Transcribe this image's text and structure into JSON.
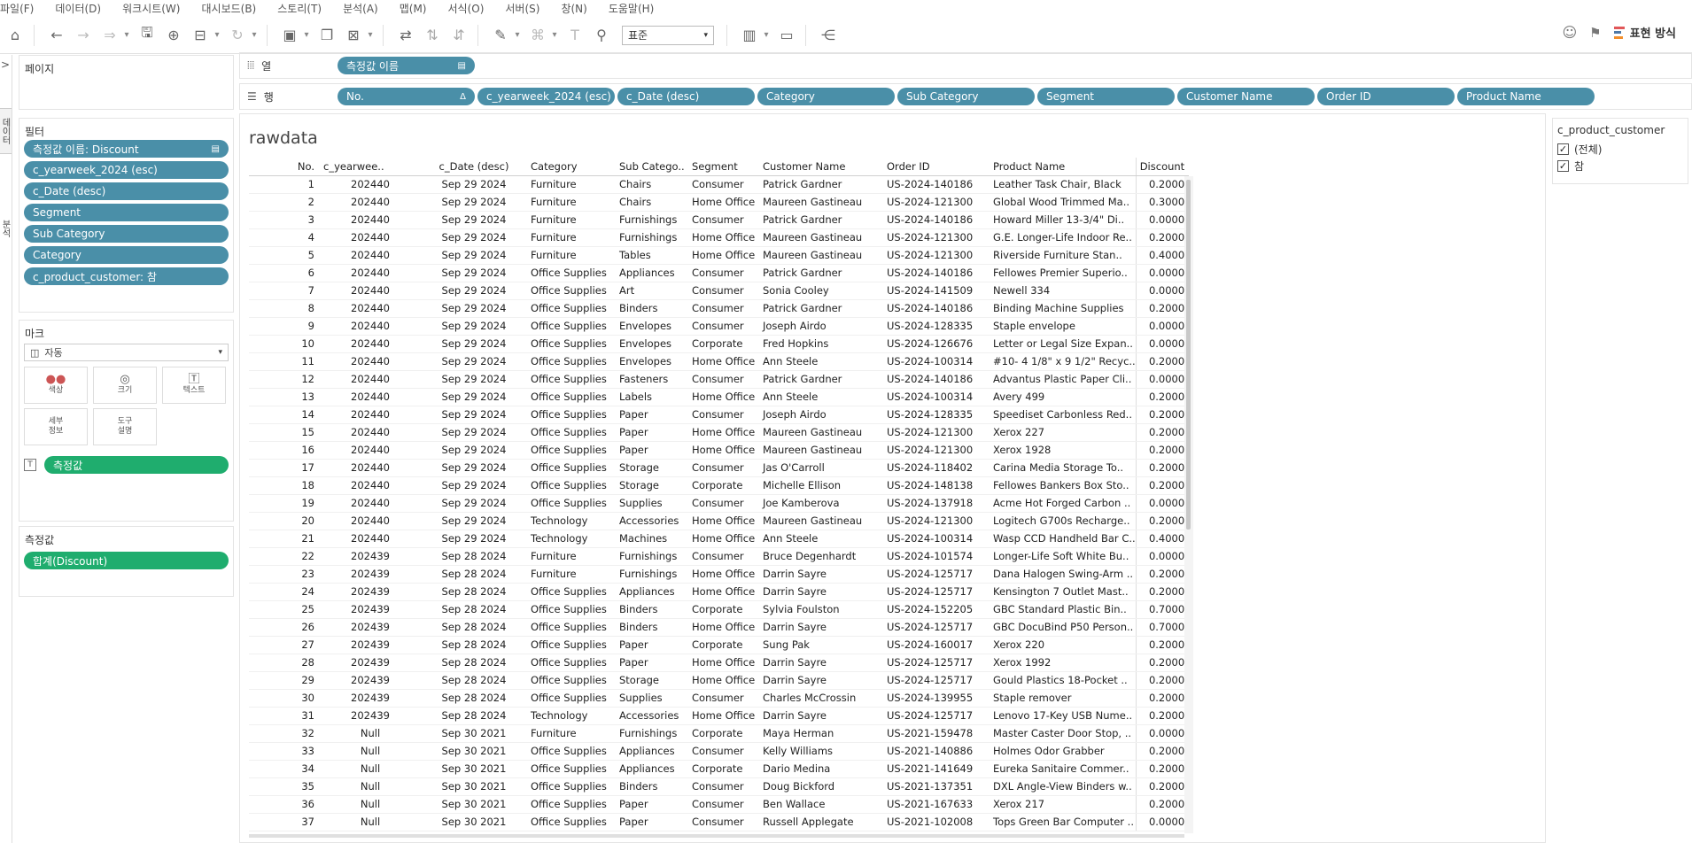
{
  "menu": [
    "파일(F)",
    "데이터(D)",
    "워크시트(W)",
    "대시보드(B)",
    "스토리(T)",
    "분석(A)",
    "맵(M)",
    "서식(O)",
    "서버(S)",
    "창(N)",
    "도움말(H)"
  ],
  "toolbar": {
    "fit_value": "표준",
    "show_me_label": "표현 방식",
    "show_me_colors": [
      "#e15759",
      "#4e79a7",
      "#f28e2b"
    ]
  },
  "left_strip": {
    "tab_top": "데이터",
    "tab_mid": "분석"
  },
  "pages_card": {
    "title": "페이지"
  },
  "filters_card": {
    "title": "필터",
    "items": [
      "측정값 이름: Discount",
      "c_yearweek_2024 (esc)",
      "c_Date (desc)",
      "Segment",
      "Sub Category",
      "Category",
      "c_product_customer: 참"
    ]
  },
  "marks_card": {
    "title": "마크",
    "type_value": "자동",
    "buttons": {
      "color": "색상",
      "size": "크기",
      "text": "텍스트",
      "detail": "세부\n정보",
      "tooltip": "도구\n설명"
    },
    "text_pill": "측정값"
  },
  "measure_values_card": {
    "title": "측정값",
    "items": [
      "합계(Discount)"
    ]
  },
  "columns_shelf": {
    "label": "열",
    "pills": [
      "측정값 이름"
    ]
  },
  "rows_shelf": {
    "label": "행",
    "pills": [
      "No.",
      "c_yearweek_2024 (esc)",
      "c_Date (desc)",
      "Category",
      "Sub Category",
      "Segment",
      "Customer Name",
      "Order ID",
      "Product Name"
    ],
    "first_pill_marker": "Δ"
  },
  "view": {
    "title": "rawdata",
    "headers": [
      "No.",
      "c_yearwee..",
      "c_Date (desc)",
      "Category",
      "Sub Catego..",
      "Segment",
      "Customer Name",
      "Order ID",
      "Product Name",
      "Discount"
    ],
    "rows": [
      [
        "1",
        "202440",
        "Sep 29 2024",
        "Furniture",
        "Chairs",
        "Consumer",
        "Patrick Gardner",
        "US-2024-140186",
        "Leather Task Chair, Black",
        "0.2000"
      ],
      [
        "2",
        "202440",
        "Sep 29 2024",
        "Furniture",
        "Chairs",
        "Home Office",
        "Maureen Gastineau",
        "US-2024-121300",
        "Global Wood Trimmed Ma..",
        "0.3000"
      ],
      [
        "3",
        "202440",
        "Sep 29 2024",
        "Furniture",
        "Furnishings",
        "Consumer",
        "Patrick Gardner",
        "US-2024-140186",
        "Howard Miller 13-3/4\" Di..",
        "0.0000"
      ],
      [
        "4",
        "202440",
        "Sep 29 2024",
        "Furniture",
        "Furnishings",
        "Home Office",
        "Maureen Gastineau",
        "US-2024-121300",
        "G.E. Longer-Life Indoor Re..",
        "0.2000"
      ],
      [
        "5",
        "202440",
        "Sep 29 2024",
        "Furniture",
        "Tables",
        "Home Office",
        "Maureen Gastineau",
        "US-2024-121300",
        "Riverside Furniture Stan..",
        "0.4000"
      ],
      [
        "6",
        "202440",
        "Sep 29 2024",
        "Office Supplies",
        "Appliances",
        "Consumer",
        "Patrick Gardner",
        "US-2024-140186",
        "Fellowes Premier Superio..",
        "0.0000"
      ],
      [
        "7",
        "202440",
        "Sep 29 2024",
        "Office Supplies",
        "Art",
        "Consumer",
        "Sonia Cooley",
        "US-2024-141509",
        "Newell 334",
        "0.0000"
      ],
      [
        "8",
        "202440",
        "Sep 29 2024",
        "Office Supplies",
        "Binders",
        "Consumer",
        "Patrick Gardner",
        "US-2024-140186",
        "Binding Machine Supplies",
        "0.2000"
      ],
      [
        "9",
        "202440",
        "Sep 29 2024",
        "Office Supplies",
        "Envelopes",
        "Consumer",
        "Joseph Airdo",
        "US-2024-128335",
        "Staple envelope",
        "0.0000"
      ],
      [
        "10",
        "202440",
        "Sep 29 2024",
        "Office Supplies",
        "Envelopes",
        "Corporate",
        "Fred Hopkins",
        "US-2024-126676",
        "Letter or Legal Size Expan..",
        "0.0000"
      ],
      [
        "11",
        "202440",
        "Sep 29 2024",
        "Office Supplies",
        "Envelopes",
        "Home Office",
        "Ann Steele",
        "US-2024-100314",
        "#10- 4 1/8\" x 9 1/2\" Recyc..",
        "0.2000"
      ],
      [
        "12",
        "202440",
        "Sep 29 2024",
        "Office Supplies",
        "Fasteners",
        "Consumer",
        "Patrick Gardner",
        "US-2024-140186",
        "Advantus Plastic Paper Cli..",
        "0.0000"
      ],
      [
        "13",
        "202440",
        "Sep 29 2024",
        "Office Supplies",
        "Labels",
        "Home Office",
        "Ann Steele",
        "US-2024-100314",
        "Avery 499",
        "0.2000"
      ],
      [
        "14",
        "202440",
        "Sep 29 2024",
        "Office Supplies",
        "Paper",
        "Consumer",
        "Joseph Airdo",
        "US-2024-128335",
        "Speediset Carbonless Red..",
        "0.2000"
      ],
      [
        "15",
        "202440",
        "Sep 29 2024",
        "Office Supplies",
        "Paper",
        "Home Office",
        "Maureen Gastineau",
        "US-2024-121300",
        "Xerox 227",
        "0.2000"
      ],
      [
        "16",
        "202440",
        "Sep 29 2024",
        "Office Supplies",
        "Paper",
        "Home Office",
        "Maureen Gastineau",
        "US-2024-121300",
        "Xerox 1928",
        "0.2000"
      ],
      [
        "17",
        "202440",
        "Sep 29 2024",
        "Office Supplies",
        "Storage",
        "Consumer",
        "Jas O'Carroll",
        "US-2024-118402",
        "Carina Media Storage To..",
        "0.2000"
      ],
      [
        "18",
        "202440",
        "Sep 29 2024",
        "Office Supplies",
        "Storage",
        "Corporate",
        "Michelle Ellison",
        "US-2024-148138",
        "Fellowes Bankers Box Sto..",
        "0.2000"
      ],
      [
        "19",
        "202440",
        "Sep 29 2024",
        "Office Supplies",
        "Supplies",
        "Consumer",
        "Joe Kamberova",
        "US-2024-137918",
        "Acme Hot Forged Carbon ..",
        "0.0000"
      ],
      [
        "20",
        "202440",
        "Sep 29 2024",
        "Technology",
        "Accessories",
        "Home Office",
        "Maureen Gastineau",
        "US-2024-121300",
        "Logitech G700s Recharge..",
        "0.2000"
      ],
      [
        "21",
        "202440",
        "Sep 29 2024",
        "Technology",
        "Machines",
        "Home Office",
        "Ann Steele",
        "US-2024-100314",
        "Wasp CCD Handheld Bar C..",
        "0.4000"
      ],
      [
        "22",
        "202439",
        "Sep 28 2024",
        "Furniture",
        "Furnishings",
        "Consumer",
        "Bruce Degenhardt",
        "US-2024-101574",
        "Longer-Life Soft White Bu..",
        "0.0000"
      ],
      [
        "23",
        "202439",
        "Sep 28 2024",
        "Furniture",
        "Furnishings",
        "Home Office",
        "Darrin Sayre",
        "US-2024-125717",
        "Dana Halogen Swing-Arm ..",
        "0.2000"
      ],
      [
        "24",
        "202439",
        "Sep 28 2024",
        "Office Supplies",
        "Appliances",
        "Home Office",
        "Darrin Sayre",
        "US-2024-125717",
        "Kensington 7 Outlet Mast..",
        "0.2000"
      ],
      [
        "25",
        "202439",
        "Sep 28 2024",
        "Office Supplies",
        "Binders",
        "Corporate",
        "Sylvia Foulston",
        "US-2024-152205",
        "GBC Standard Plastic Bin..",
        "0.7000"
      ],
      [
        "26",
        "202439",
        "Sep 28 2024",
        "Office Supplies",
        "Binders",
        "Home Office",
        "Darrin Sayre",
        "US-2024-125717",
        "GBC DocuBind P50 Person..",
        "0.7000"
      ],
      [
        "27",
        "202439",
        "Sep 28 2024",
        "Office Supplies",
        "Paper",
        "Corporate",
        "Sung Pak",
        "US-2024-160017",
        "Xerox 220",
        "0.2000"
      ],
      [
        "28",
        "202439",
        "Sep 28 2024",
        "Office Supplies",
        "Paper",
        "Home Office",
        "Darrin Sayre",
        "US-2024-125717",
        "Xerox 1992",
        "0.2000"
      ],
      [
        "29",
        "202439",
        "Sep 28 2024",
        "Office Supplies",
        "Storage",
        "Home Office",
        "Darrin Sayre",
        "US-2024-125717",
        "Gould Plastics 18-Pocket ..",
        "0.2000"
      ],
      [
        "30",
        "202439",
        "Sep 28 2024",
        "Office Supplies",
        "Supplies",
        "Consumer",
        "Charles McCrossin",
        "US-2024-139955",
        "Staple remover",
        "0.2000"
      ],
      [
        "31",
        "202439",
        "Sep 28 2024",
        "Technology",
        "Accessories",
        "Home Office",
        "Darrin Sayre",
        "US-2024-125717",
        "Lenovo 17-Key USB Nume..",
        "0.2000"
      ],
      [
        "32",
        "Null",
        "Sep 30 2021",
        "Furniture",
        "Furnishings",
        "Corporate",
        "Maya Herman",
        "US-2021-159478",
        "Master Caster Door Stop, ..",
        "0.0000"
      ],
      [
        "33",
        "Null",
        "Sep 30 2021",
        "Office Supplies",
        "Appliances",
        "Consumer",
        "Kelly Williams",
        "US-2021-140886",
        "Holmes Odor Grabber",
        "0.2000"
      ],
      [
        "34",
        "Null",
        "Sep 30 2021",
        "Office Supplies",
        "Appliances",
        "Corporate",
        "Dario Medina",
        "US-2021-141649",
        "Eureka Sanitaire  Commer..",
        "0.2000"
      ],
      [
        "35",
        "Null",
        "Sep 30 2021",
        "Office Supplies",
        "Binders",
        "Consumer",
        "Doug Bickford",
        "US-2021-137351",
        "DXL Angle-View Binders w..",
        "0.2000"
      ],
      [
        "36",
        "Null",
        "Sep 30 2021",
        "Office Supplies",
        "Paper",
        "Consumer",
        "Ben Wallace",
        "US-2021-167633",
        "Xerox 217",
        "0.2000"
      ],
      [
        "37",
        "Null",
        "Sep 30 2021",
        "Office Supplies",
        "Paper",
        "Consumer",
        "Russell Applegate",
        "US-2021-102008",
        "Tops Green Bar Computer ..",
        "0.0000"
      ]
    ]
  },
  "filter_card": {
    "title": "c_product_customer",
    "options": [
      "(전체)",
      "참"
    ],
    "checked": [
      true,
      true
    ]
  }
}
